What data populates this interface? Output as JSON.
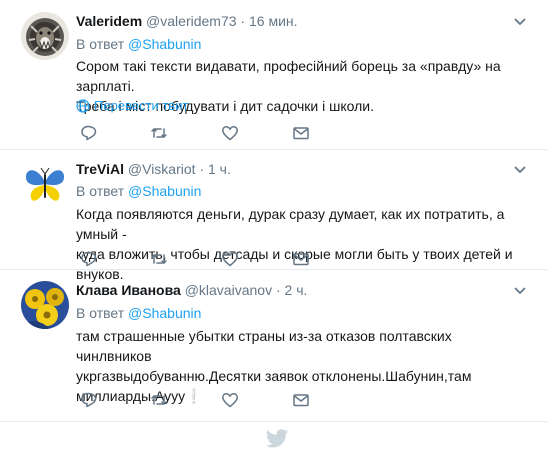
{
  "tweets": [
    {
      "name": "Valeridem",
      "handle": "@valeridem73",
      "separator": "·",
      "time": "16 мин.",
      "reply_prefix": "В ответ",
      "reply_to": "@Shabunin",
      "lines": [
        "Сором такі тексти видавати, професійний борець за «правду» на зарплаті.",
        "Треба і міст побудувати і дит садочки і школи."
      ],
      "translate_label": "Перевести твит",
      "avatar_icon": "lion-avatar"
    },
    {
      "name": "TreViAl",
      "handle": "@Viskariot",
      "separator": "·",
      "time": "1 ч.",
      "reply_prefix": "В ответ",
      "reply_to": "@Shabunin",
      "lines": [
        "Когда появляются деньги, дурак сразу думает, как их потратить, а умный -",
        "куда вложить, чтобы детсады и скорые могли быть у твоих детей и внуков."
      ],
      "avatar_icon": "butterfly-flag-avatar"
    },
    {
      "name": "Клава Иванова",
      "handle": "@klavaivanov",
      "separator": "·",
      "time": "2 ч.",
      "reply_prefix": "В ответ",
      "reply_to": "@Shabunin",
      "lines": [
        "там страшенные убытки страны из-за отказов полтавских чинлвников",
        "укргазвыдобуванню.Десятки заявок отклонены.Шабунин,там",
        "миллиарды.Аууу"
      ],
      "emoji": "❕",
      "avatar_icon": "flower-avatar"
    }
  ],
  "colors": {
    "accent": "#1da1f2",
    "muted": "#657786",
    "icon": "#657786",
    "divider": "#e6ecf0"
  },
  "icons": [
    "reply-icon",
    "retweet-icon",
    "like-icon",
    "message-icon",
    "chevron-down-icon",
    "globe-icon",
    "twitter-bird-icon"
  ]
}
